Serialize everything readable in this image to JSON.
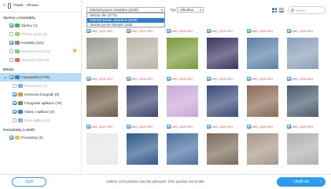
{
  "device": {
    "name": "Patek - iPhone"
  },
  "sidebar": {
    "sections": [
      {
        "title": "Zprávy a kontakty"
      },
      {
        "title": "Média"
      },
      {
        "title": "Poznámky a další"
      }
    ],
    "items": [
      {
        "label": "Zprávy (4)",
        "check": "on",
        "color": "#3fb44a"
      },
      {
        "label": "Přílohy zpráv (0)",
        "check": "off",
        "color": "#9bd18e",
        "dim": true
      },
      {
        "label": "Kontakty (221)",
        "check": "on",
        "color": "#8a8a8a"
      },
      {
        "label": "Historie hovorů (0)",
        "check": "off",
        "color": "#7ccf6a",
        "dim": true
      },
      {
        "label": "Hlasová pošta (0)",
        "check": "off",
        "color": "#e26b5a",
        "dim": true
      },
      {
        "label": "Fotoaparát (2778)",
        "check": "on",
        "color": "#3d7fbf",
        "selected": true,
        "expand": true
      },
      {
        "label": "Prezentace (0)",
        "check": "off",
        "color": "#7faedc",
        "dim": true
      },
      {
        "label": "Knihovna fotografií (9)",
        "check": "on",
        "color": "#e88e3c"
      },
      {
        "label": "Fotografie aplikace (78)",
        "check": "on",
        "color": "#5a9e5a"
      },
      {
        "label": "Videa z aplikací (0)",
        "check": "on",
        "color": "#4a7db5"
      },
      {
        "label": "Zvuk aplikací (0)",
        "check": "off",
        "color": "#9aa8c0",
        "dim": true
      },
      {
        "label": "Poznámky (0)",
        "check": "on",
        "color": "#e8c64a"
      }
    ],
    "warn_icon": "warning-icon"
  },
  "toolbar": {
    "filter_value": "Zobrazit pouze smazáno (2240)",
    "filter_options": [
      "Ukázat vše (2775)",
      "Zobrazit pouze smazáno (2240)",
      "Ukázat pouze stávající (535)"
    ],
    "type_label": "Typ:",
    "type_value": "Všechno",
    "search_placeholder": "Hledat"
  },
  "grid": {
    "rows": [
      {
        "captions": [
          "IMG_0021.JPG",
          "IMG_0022.JPG",
          "IMG_0023.JPG",
          "IMG_0024.JPG",
          "IMG_0025.JPG",
          "IMG_0026.JPG"
        ]
      },
      {
        "captions": [
          "IMG_0031.JPG",
          "IMG_0032.JPG",
          "IMG_0033.JPG",
          "IMG_0034.JPG",
          "IMG_0035.JPG",
          "IMG_0036.JPG"
        ]
      },
      {
        "captions": [
          "IMG_0041.JPG",
          "IMG_0042.JPG",
          "IMG_0043.JPG",
          "IMG_0044.JPG",
          "IMG_0045.JPG",
          "IMG_0046.JPG"
        ]
      }
    ],
    "thumbs": [
      [
        "#9a9a90",
        "#b8b2a6",
        "#7a9a3a",
        "#3a3560",
        "#5a7fa8",
        "#8aa0b8"
      ],
      [
        "#6e5a48",
        "#3c4670",
        "#c9a8d8",
        "#3a4a7a",
        "#8a6a55",
        "#4a5a6e"
      ],
      [
        "#e8e8e8",
        "#2f5a8a",
        "#4a6fa0",
        "#7a6a5a",
        "#a89888",
        "#b0b0b0"
      ]
    ]
  },
  "bottom": {
    "back_label": "Zpět",
    "status": "Celkem: 4474 položek 3.56 GB   vybraných: 3761 položek 433.62 MB",
    "recover_label": "Uložit do"
  }
}
